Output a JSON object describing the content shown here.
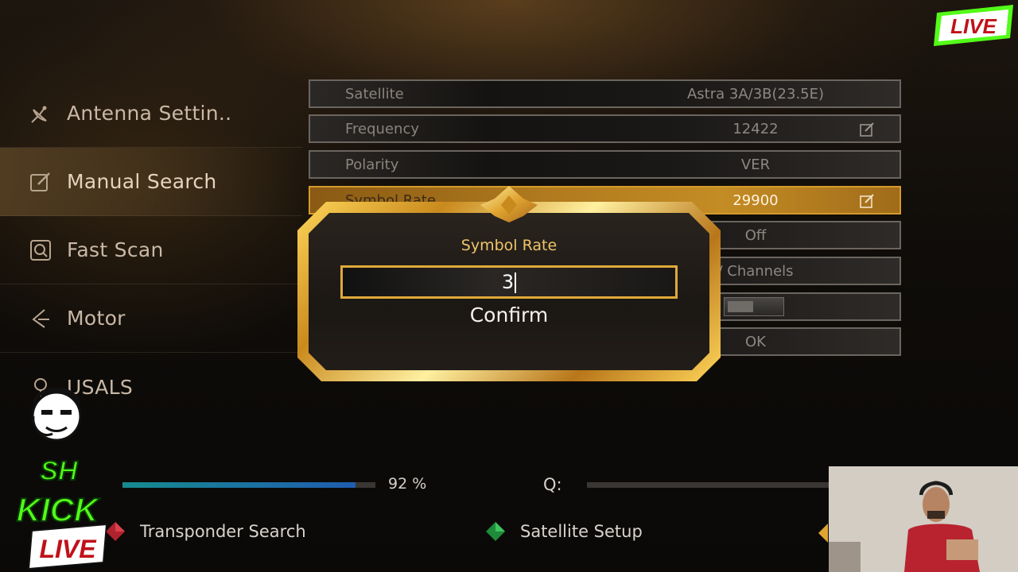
{
  "sidebar": {
    "items": [
      {
        "label": "Antenna Settin..",
        "icon": "satellite-dish-icon",
        "active": false
      },
      {
        "label": "Manual Search",
        "icon": "edit-icon",
        "active": true
      },
      {
        "label": "Fast Scan",
        "icon": "search-icon",
        "active": false
      },
      {
        "label": "Motor",
        "icon": "motor-icon",
        "active": false
      },
      {
        "label": "USALS",
        "icon": "location-icon",
        "active": false
      }
    ]
  },
  "settings": {
    "rows": [
      {
        "label": "Satellite",
        "value": "Astra 3A/3B(23.5E)"
      },
      {
        "label": "Frequency",
        "value": "12422"
      },
      {
        "label": "Polarity",
        "value": "VER"
      },
      {
        "label": "Symbol Rate",
        "value": "29900"
      },
      {
        "value": "Off"
      },
      {
        "value": "/ Channels"
      },
      {
        "value": "OK"
      }
    ]
  },
  "dialog": {
    "title": "Symbol Rate",
    "input_value": "3",
    "confirm_label": "Confirm"
  },
  "signal": {
    "strength_percent": 92,
    "strength_label": "92 %",
    "quality_label": "Q:"
  },
  "legend": {
    "red_label": "Transponder Search",
    "green_label": "Satellite Setup"
  },
  "overlay": {
    "live_badge": "LIVE",
    "kick_top": "SH",
    "kick_mid": "KICK",
    "kick_bottom": "LIVE"
  },
  "colors": {
    "accent_gold": "#d49a2a",
    "progress_start": "#168b8f",
    "progress_end": "#1f5db0",
    "kick_green": "#53fc18"
  }
}
